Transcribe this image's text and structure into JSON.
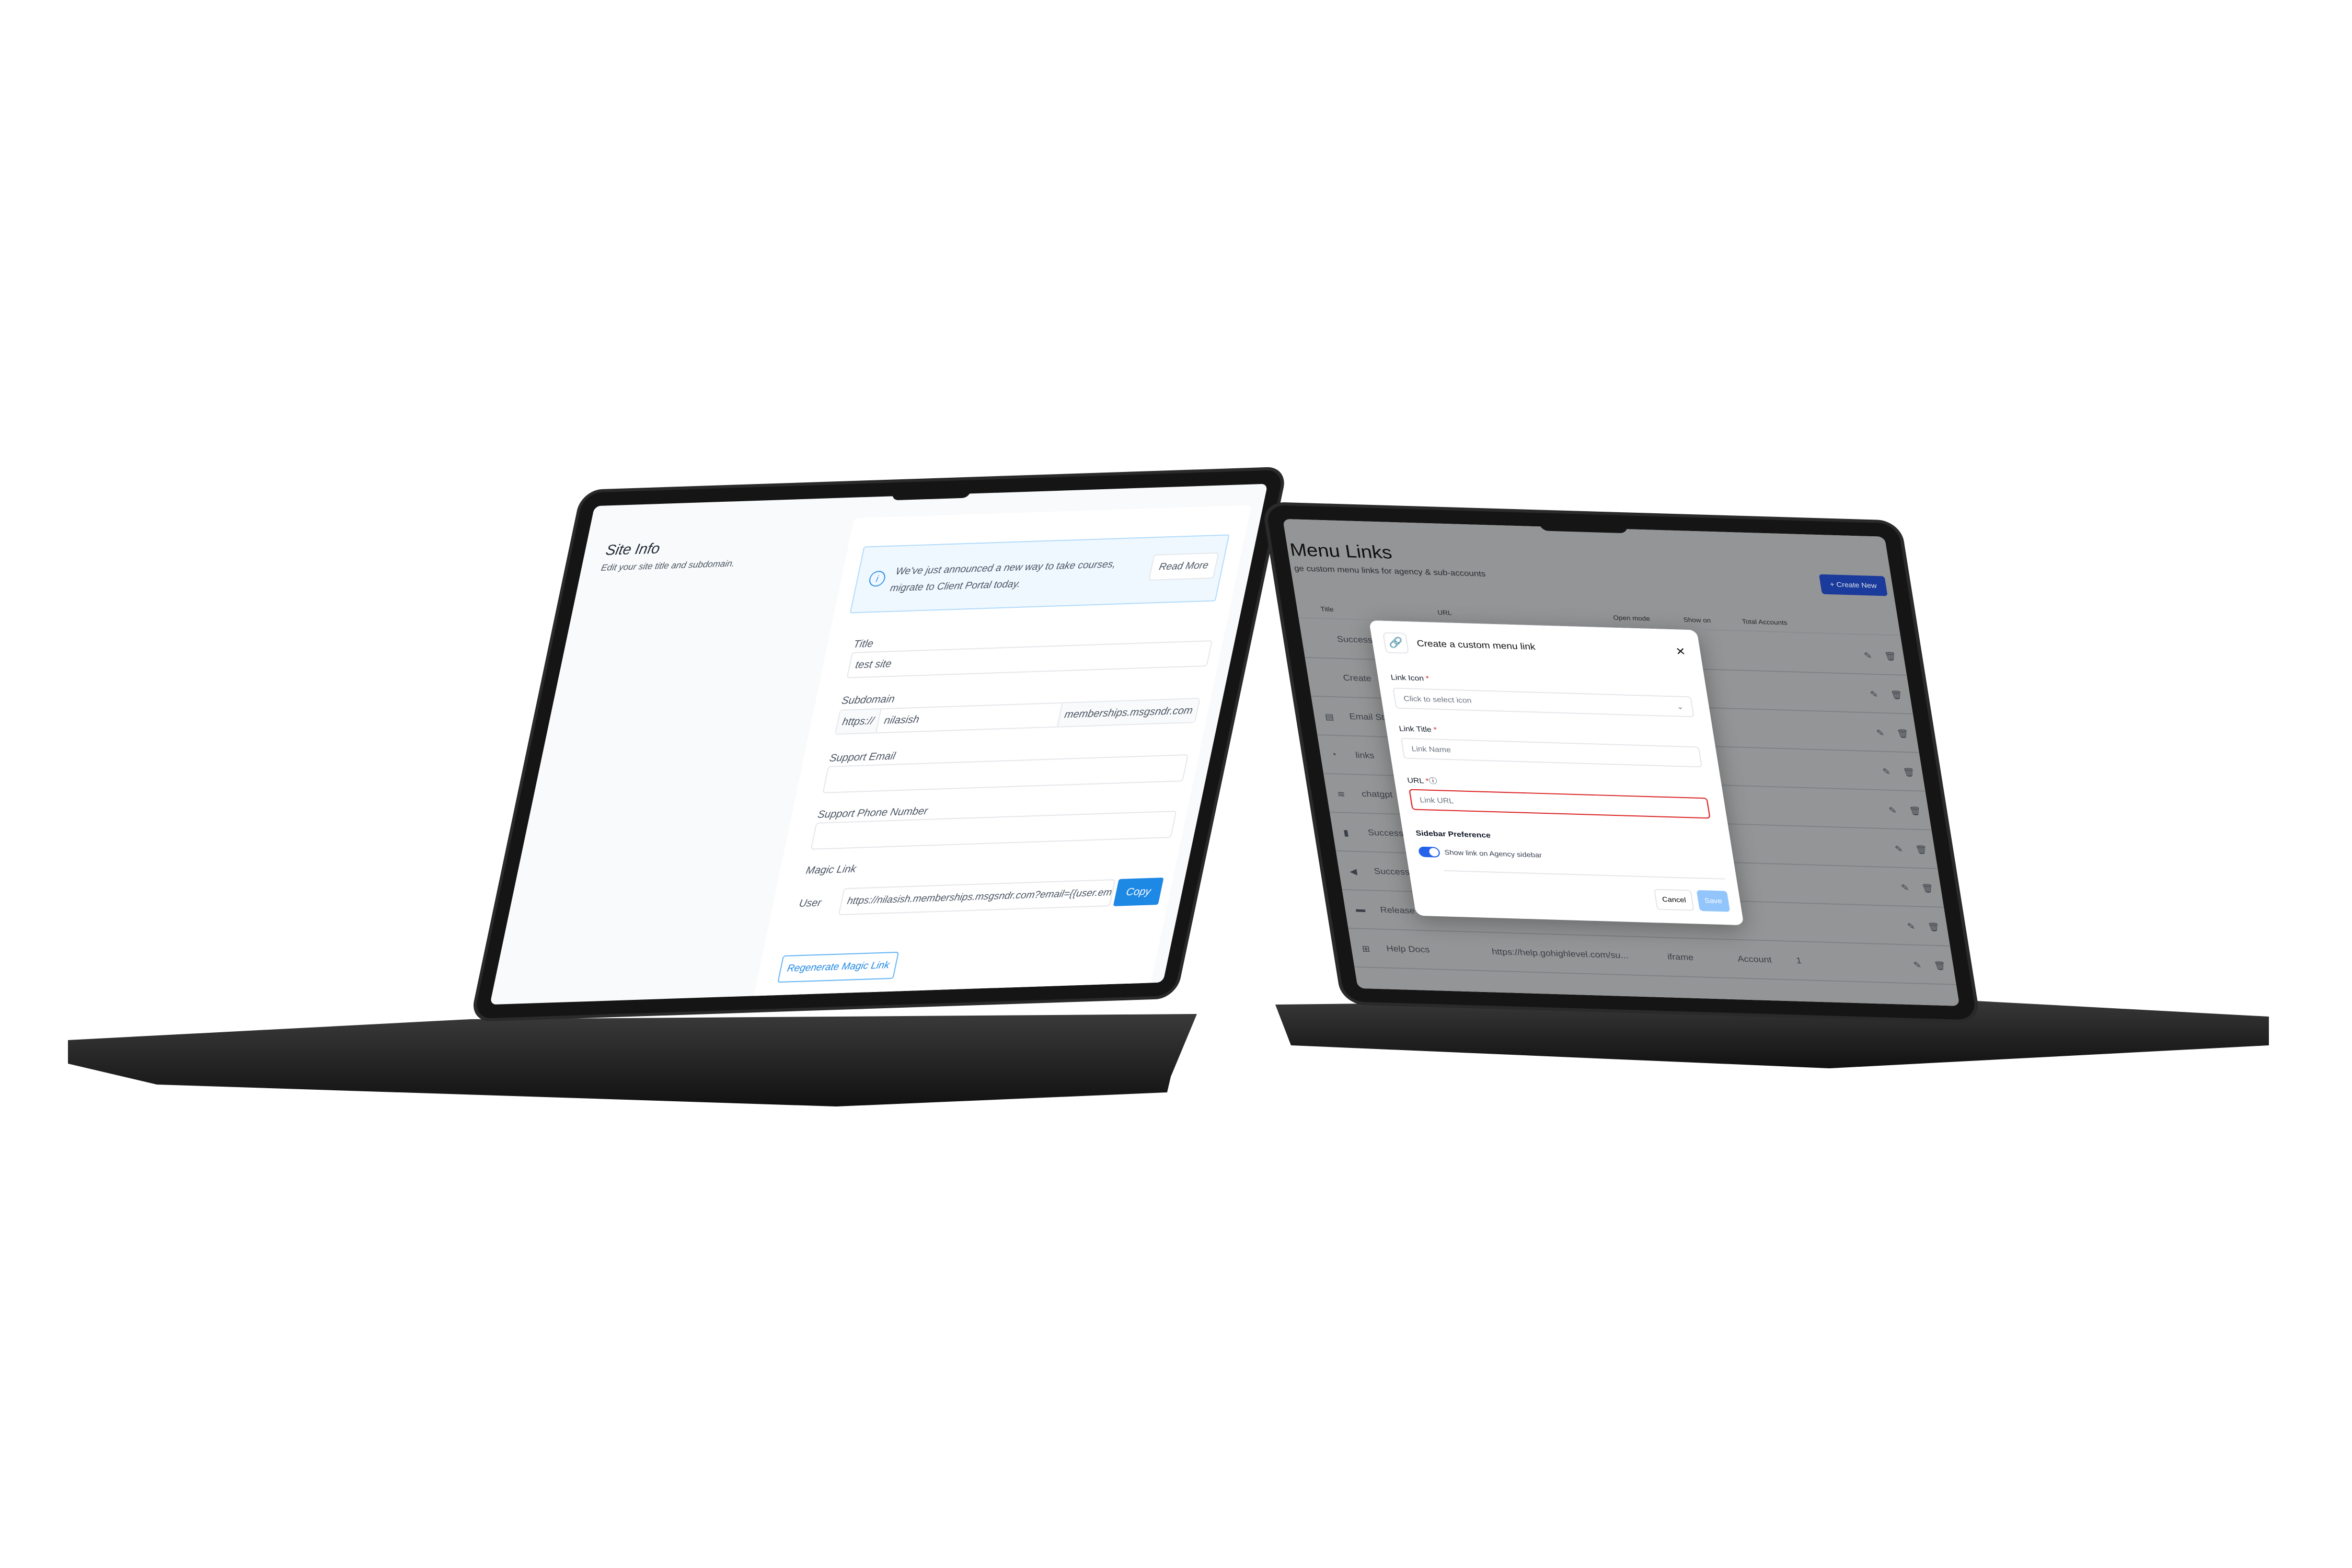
{
  "left_screen": {
    "section_title": "Site Info",
    "section_subtitle": "Edit your site title and subdomain.",
    "banner": {
      "text_line1": "We've just announced a new way to take courses,",
      "text_line2": "migrate to Client Portal today.",
      "button": "Read More",
      "icon": "info-icon"
    },
    "title": {
      "label": "Title",
      "value": "test site"
    },
    "subdomain": {
      "label": "Subdomain",
      "prefix": "https://",
      "value": "nilasish",
      "suffix": "memberships.msgsndr.com"
    },
    "support_email": {
      "label": "Support Email",
      "value": ""
    },
    "support_phone": {
      "label": "Support Phone Number",
      "value": ""
    },
    "magic_link": {
      "label": "Magic Link",
      "user_label": "User",
      "value": "https://nilasish.memberships.msgsndr.com?email={{user.email}}",
      "copy_button": "Copy",
      "regenerate_button": "Regenerate Magic Link"
    },
    "colors": {
      "primary": "#1e88e5",
      "banner_bg": "#eff8ff"
    }
  },
  "right_screen": {
    "page_title": "Menu Links",
    "page_subtitle": "ge custom menu links for agency & sub-accounts",
    "create_button": "+ Create New",
    "columns": [
      "Title",
      "URL",
      "Open mode",
      "Show on",
      "Total Accounts"
    ],
    "rows": [
      {
        "icon": "",
        "title": "Success Stats"
      },
      {
        "icon": "",
        "title": "Create"
      },
      {
        "icon": "document-icon",
        "title": "Email Statistic"
      },
      {
        "icon": "clock-icon",
        "title": "links"
      },
      {
        "icon": "wifi-icon",
        "title": "chatgpt"
      },
      {
        "icon": "book-icon",
        "title": "Success Guid"
      },
      {
        "icon": "megaphone-icon",
        "title": "Success Quic"
      },
      {
        "icon": "card-icon",
        "title": "Release Videc"
      },
      {
        "icon": "windows-icon",
        "title": "Help Docs",
        "url": "https://help.gohighlevel.com/su...",
        "open_mode": "iframe",
        "show_on": "Account",
        "total_accounts": "1"
      }
    ],
    "modal": {
      "title": "Create a custom menu link",
      "link_icon_label": "Link Icon",
      "link_icon_placeholder": "Click to select icon",
      "link_title_label": "Link Title",
      "link_title_placeholder": "Link Name",
      "url_label": "URL",
      "url_placeholder": "Link URL",
      "sidebar_heading": "Sidebar Preference",
      "toggle_label": "Show link on Agency sidebar",
      "toggle_on": true,
      "cancel": "Cancel",
      "save": "Save",
      "required_mark": "*"
    },
    "colors": {
      "primary": "#1d4ed8",
      "toggle": "#2563eb",
      "save_disabled": "#93c5fd",
      "error": "#dc2626"
    }
  }
}
